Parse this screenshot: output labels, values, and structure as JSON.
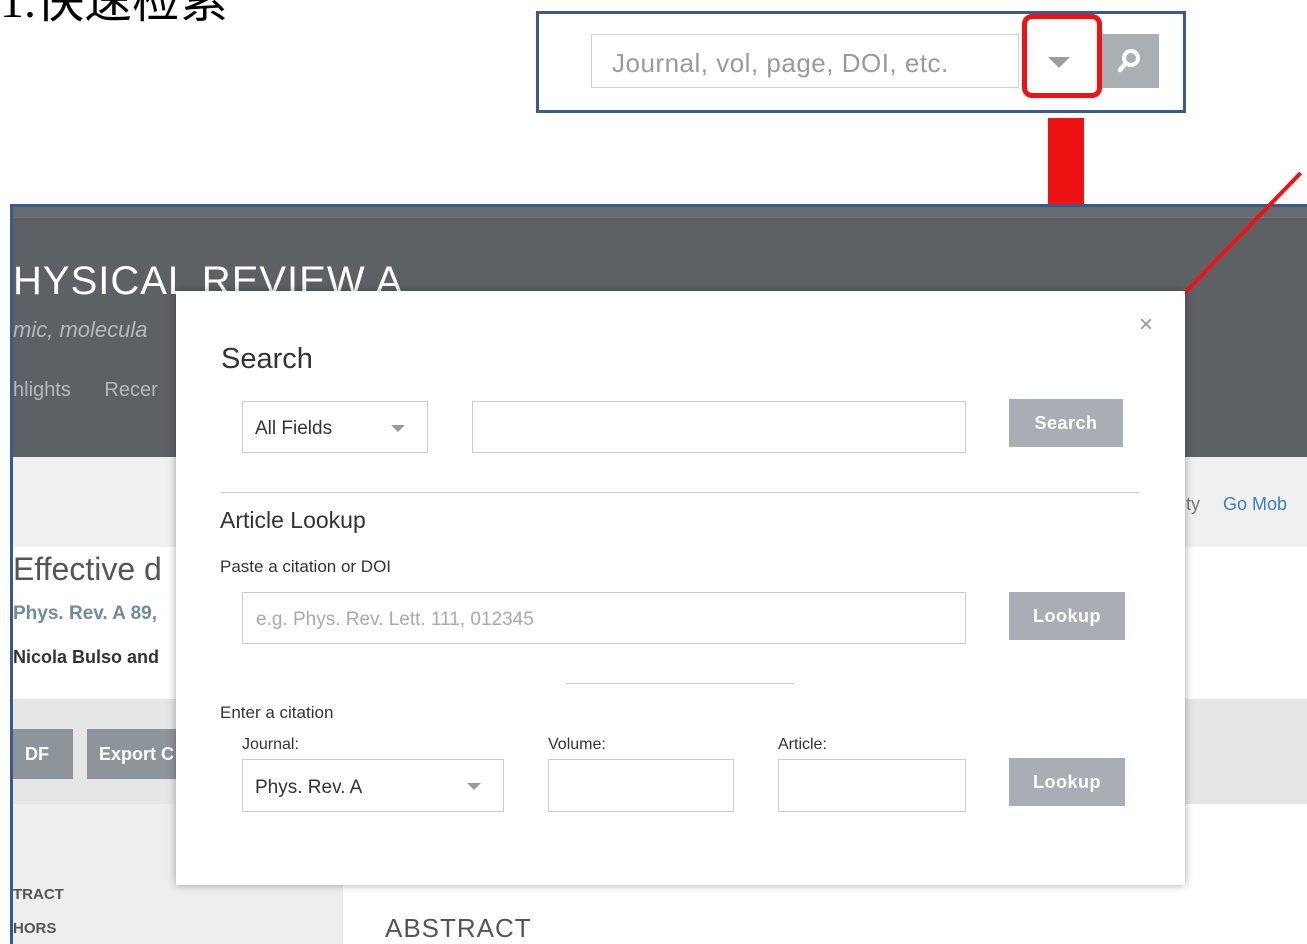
{
  "slide_title": "1.快速检索",
  "quick_search": {
    "placeholder": "Journal, vol, page, DOI, etc.",
    "dropdown_icon": "chevron-down-icon",
    "search_icon": "search-icon"
  },
  "background_page": {
    "journal_title": "HYSICAL REVIEW A",
    "subtitle": "mic, molecula",
    "nav": [
      "hlights",
      "Recer"
    ],
    "right_links": [
      "sity",
      "Go Mob"
    ],
    "article_title": "Effective d",
    "journal_ref": "Phys. Rev. A 89,",
    "authors": "Nicola Bulso and",
    "toolbar_buttons": [
      "DF",
      "Export C"
    ],
    "side_items": [
      "TRACT",
      "HORS"
    ],
    "section_heading": "ABSTRACT"
  },
  "modal": {
    "close_label": "×",
    "search_heading": "Search",
    "field_select": "All Fields",
    "search_value": "",
    "search_button": "Search",
    "article_lookup_heading": "Article Lookup",
    "paste_label": "Paste a citation or DOI",
    "citation_placeholder": "e.g. Phys. Rev. Lett. 111, 012345",
    "lookup_button_1": "Lookup",
    "enter_citation_label": "Enter a citation",
    "journal_label": "Journal:",
    "journal_value": "Phys. Rev. A",
    "volume_label": "Volume:",
    "volume_value": "",
    "article_label": "Article:",
    "article_value": "",
    "lookup_button_2": "Lookup"
  },
  "colors": {
    "accent_red": "#ee1212",
    "frame_blue": "#3a5a8c",
    "header_gray": "#5d6165",
    "button_gray": "#a8aeb3"
  }
}
